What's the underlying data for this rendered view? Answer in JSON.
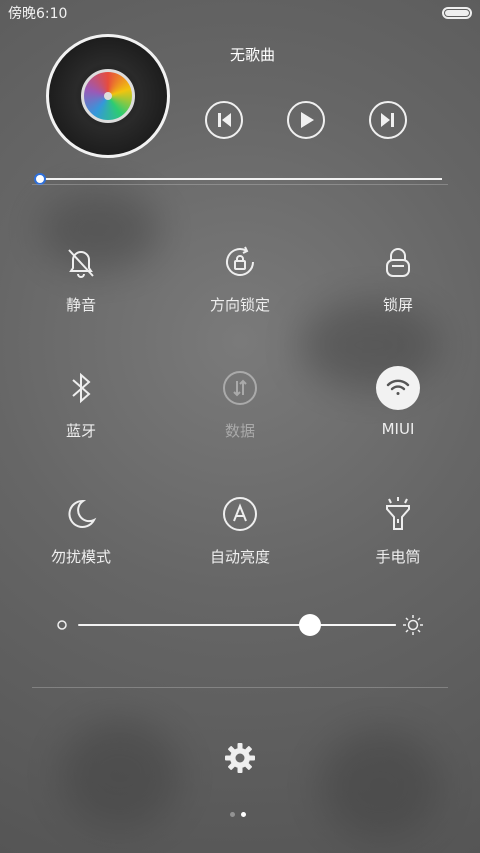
{
  "status_bar": {
    "time": "傍晚6:10",
    "battery_icon": "battery-full-icon"
  },
  "media": {
    "song_title": "无歌曲",
    "progress": 0,
    "controls": [
      "previous-icon",
      "play-icon",
      "next-icon"
    ]
  },
  "toggles": [
    {
      "label": "静音",
      "icon": "bell-off-icon",
      "enabled": true
    },
    {
      "label": "方向锁定",
      "icon": "rotation-lock-icon",
      "enabled": true
    },
    {
      "label": "锁屏",
      "icon": "lock-icon",
      "enabled": true
    },
    {
      "label": "蓝牙",
      "icon": "bluetooth-icon",
      "enabled": true
    },
    {
      "label": "数据",
      "icon": "mobile-data-icon",
      "enabled": false
    },
    {
      "label": "MIUI",
      "icon": "wifi-icon",
      "enabled": true,
      "active": true
    },
    {
      "label": "勿扰模式",
      "icon": "moon-icon",
      "enabled": true
    },
    {
      "label": "自动亮度",
      "icon": "auto-brightness-icon",
      "enabled": true
    },
    {
      "label": "手电筒",
      "icon": "flashlight-icon",
      "enabled": true
    }
  ],
  "brightness": {
    "level": 0.73,
    "low_icon": "brightness-low-icon",
    "high_icon": "brightness-high-icon"
  },
  "footer": {
    "settings_icon": "gear-icon",
    "page_indicator": {
      "total": 2,
      "current": 2
    }
  },
  "colors": {
    "accent": "#2f6fd8",
    "foreground": "#f2f2f2"
  }
}
